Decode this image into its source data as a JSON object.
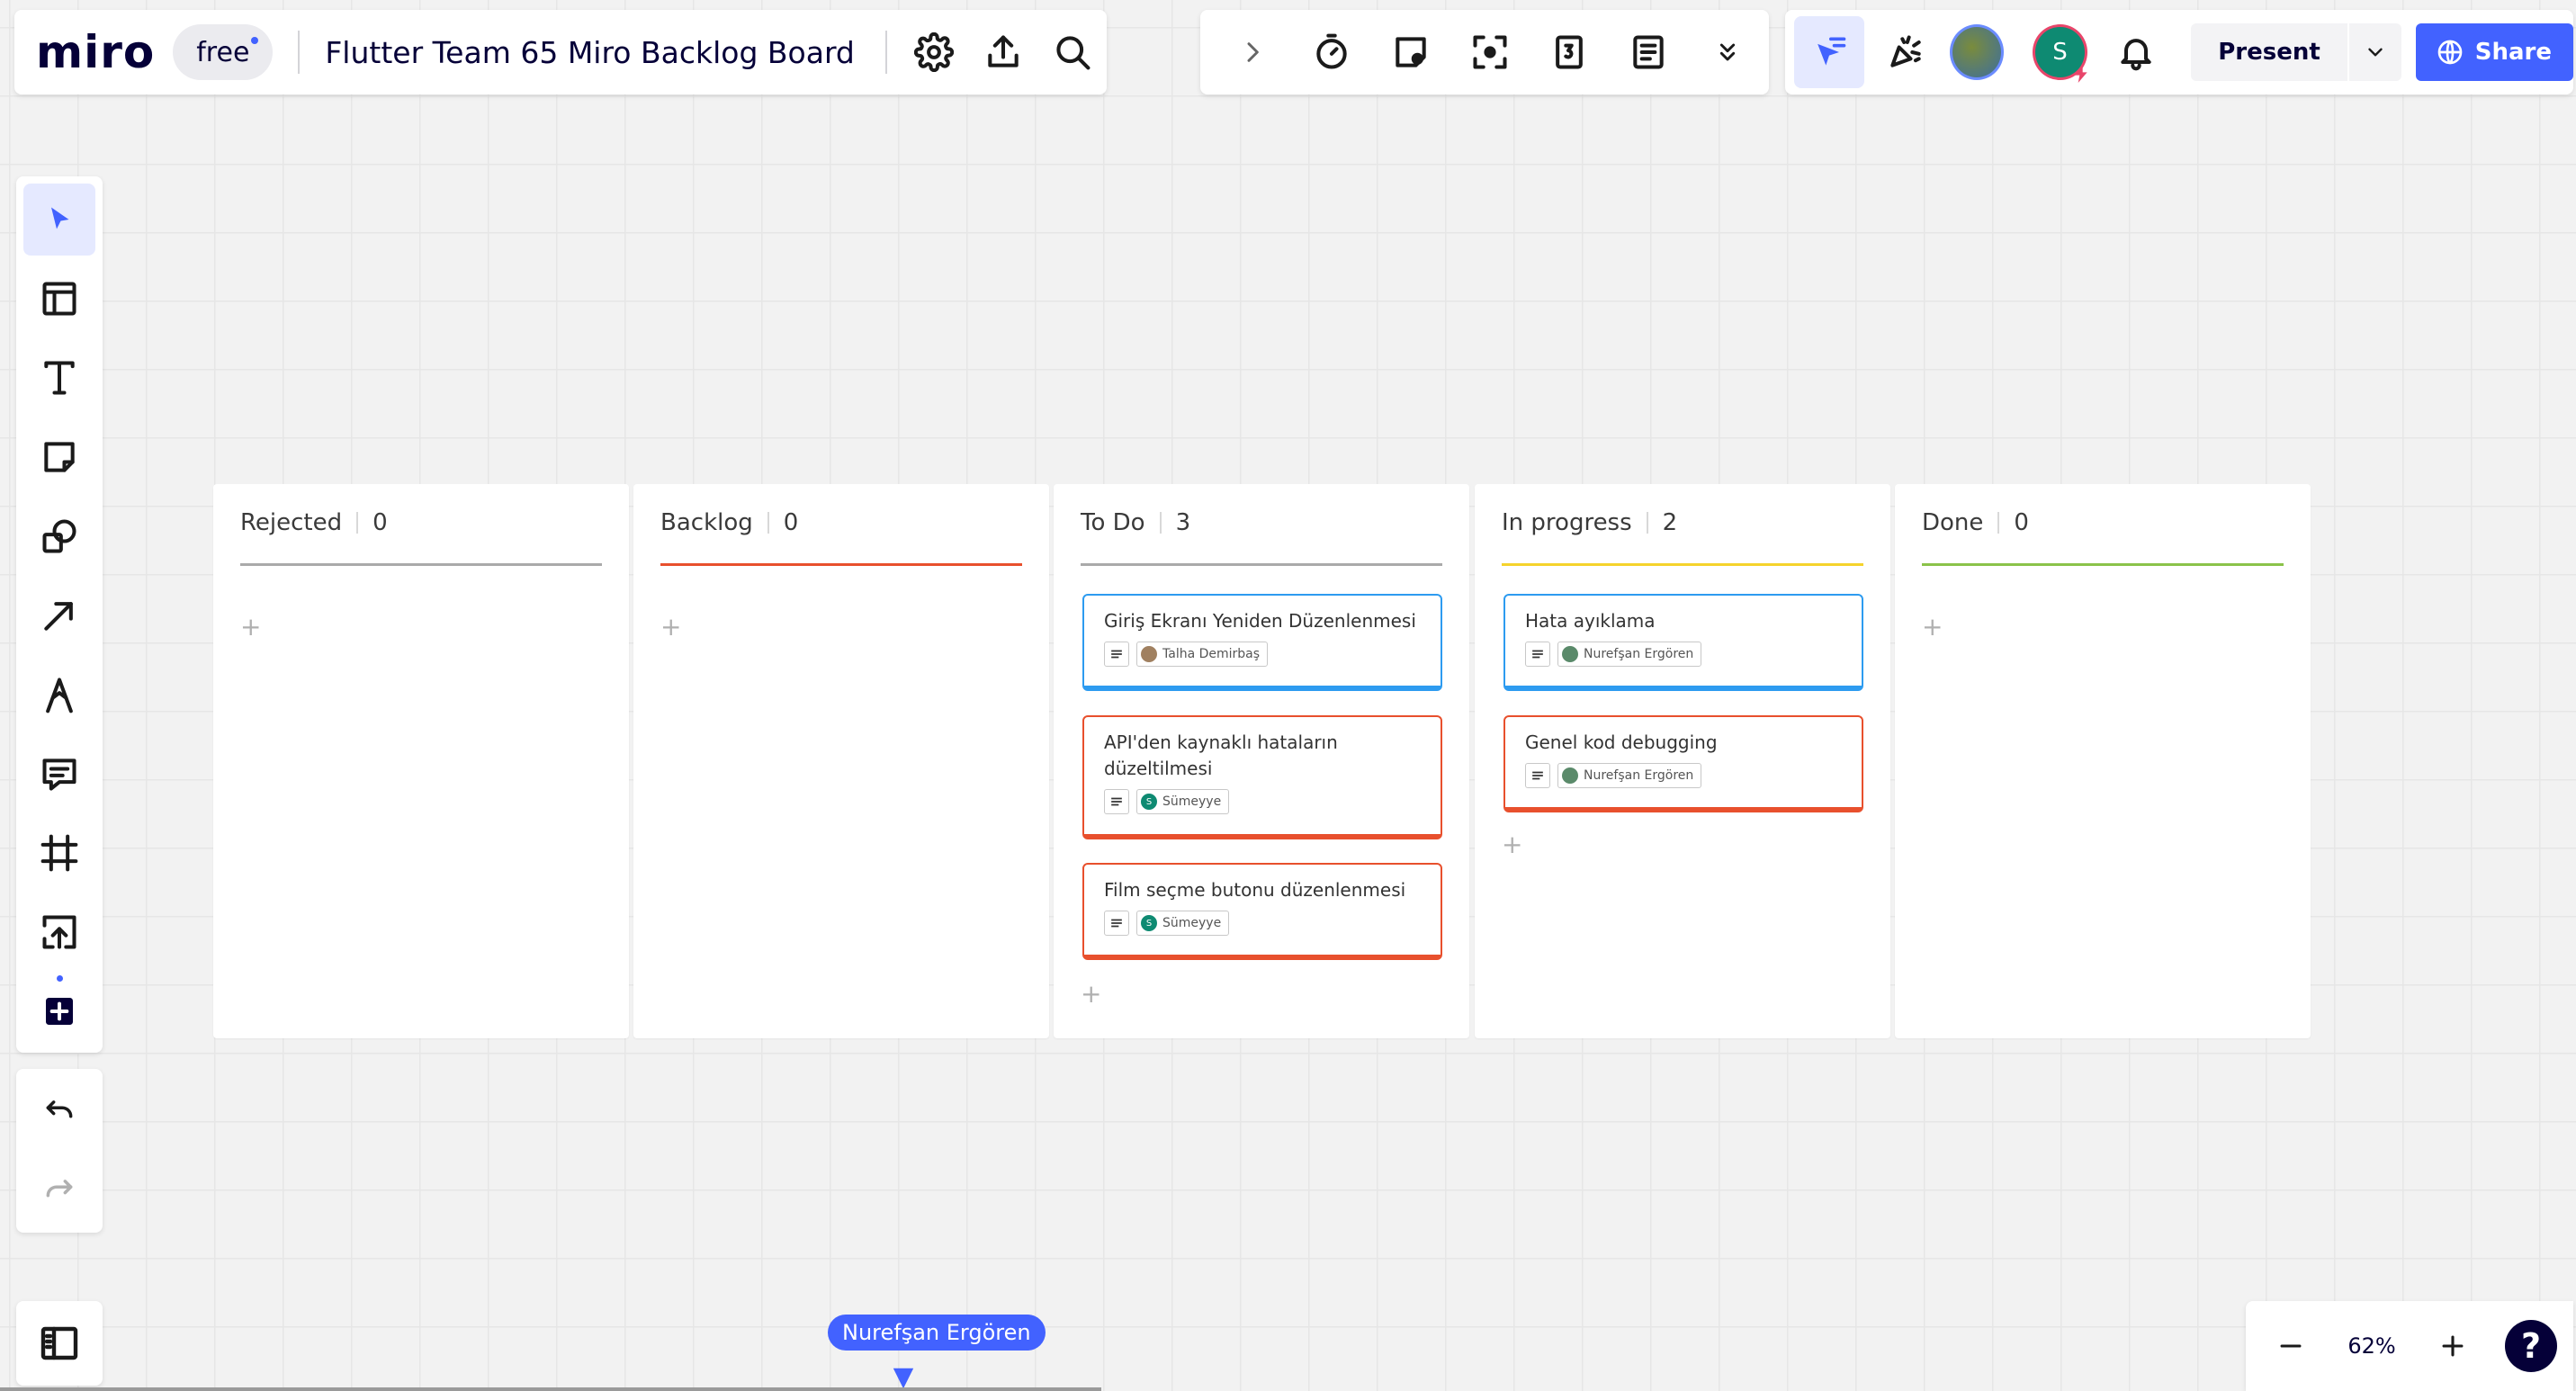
{
  "app": {
    "logo": "miro",
    "plan": "free",
    "board_title": "Flutter Team 65 Miro Backlog Board"
  },
  "topbar_right": {
    "present_label": "Present",
    "share_label": "Share",
    "collaborators": [
      {
        "name": "avatar-image",
        "initial": ""
      },
      {
        "name": "avatar-s",
        "initial": "S"
      }
    ]
  },
  "colors": {
    "accent": "#4262ff",
    "rejected": "#aaaaaa",
    "backlog": "#e8502d",
    "todo": "#aaaaaa",
    "in_progress": "#f5d32c",
    "done": "#8bc34a",
    "card_blue": "#2d9bf0",
    "card_red": "#e8502d"
  },
  "kanban": {
    "columns": [
      {
        "title": "Rejected",
        "count": "0",
        "cards": []
      },
      {
        "title": "Backlog",
        "count": "0",
        "cards": []
      },
      {
        "title": "To Do",
        "count": "3",
        "cards": [
          {
            "title": "Giriş Ekranı Yeniden Düzenlenmesi",
            "assignee": "Talha Demirbaş",
            "color": "blue"
          },
          {
            "title": "API'den kaynaklı hataların düzeltilmesi",
            "assignee": "Sümeyye",
            "color": "red"
          },
          {
            "title": "Film seçme butonu düzenlenmesi",
            "assignee": "Sümeyye",
            "color": "red"
          }
        ]
      },
      {
        "title": "In progress",
        "count": "2",
        "cards": [
          {
            "title": "Hata ayıklama",
            "assignee": "Nurefşan Ergören",
            "color": "blue"
          },
          {
            "title": "Genel kod debugging",
            "assignee": "Nurefşan Ergören",
            "color": "red"
          }
        ]
      },
      {
        "title": "Done",
        "count": "0",
        "cards": []
      }
    ]
  },
  "cursor_user": "Nurefşan Ergören",
  "zoom": {
    "level": "62%"
  },
  "help_label": "?"
}
